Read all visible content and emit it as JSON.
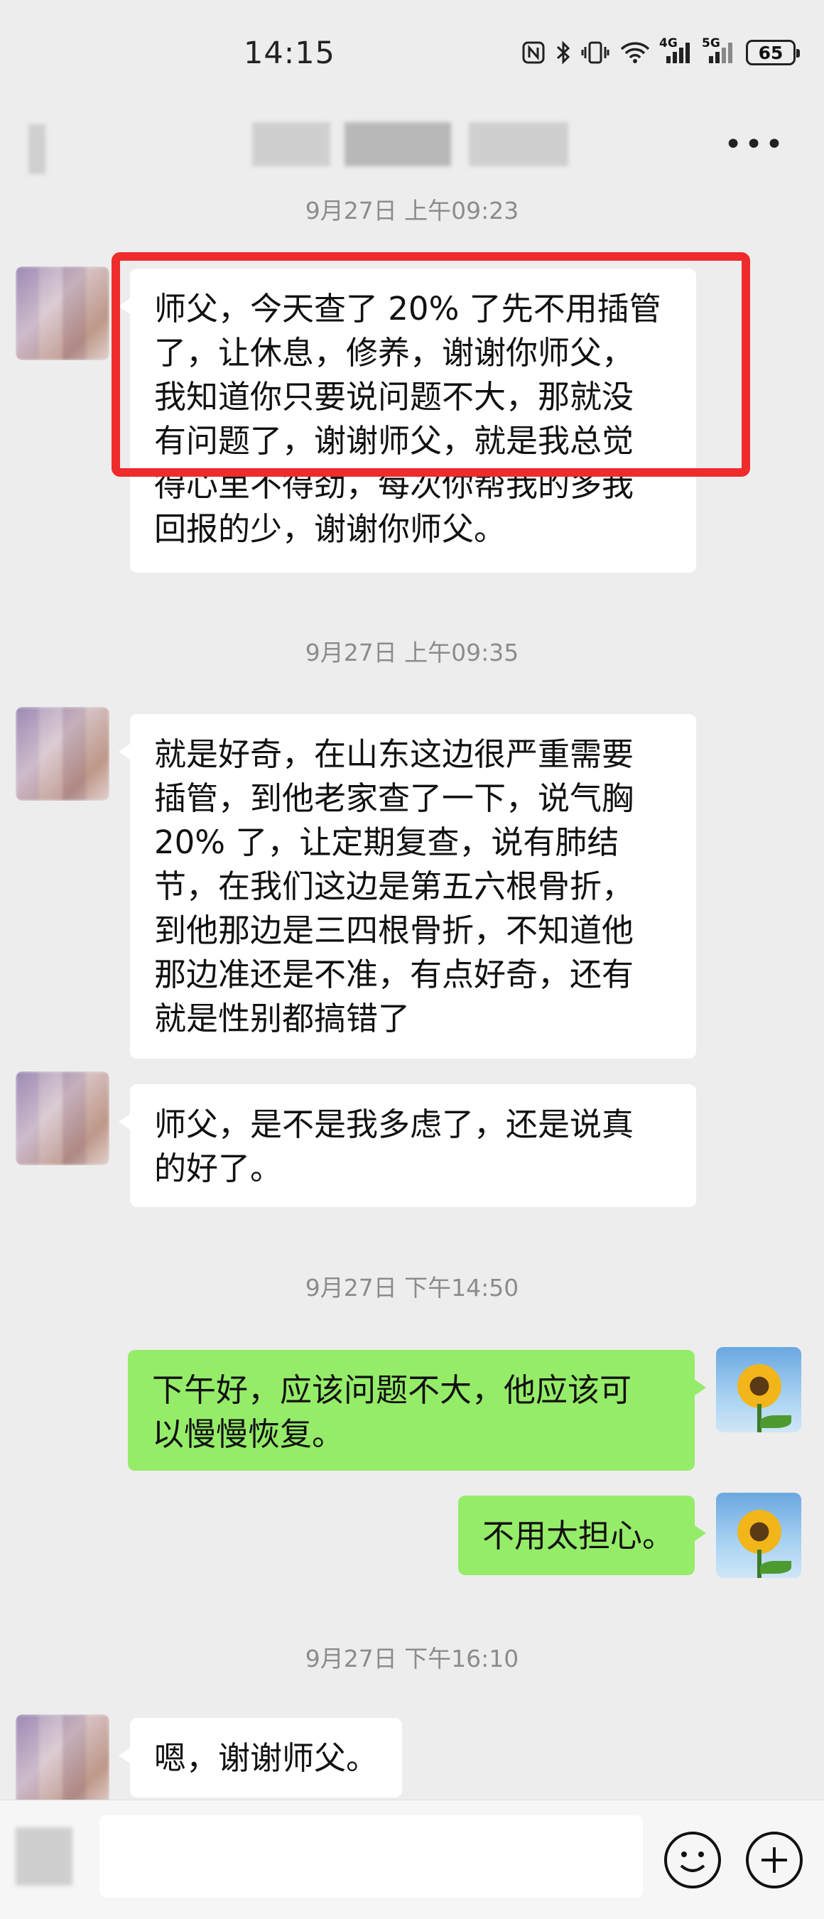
{
  "status_bar": {
    "time": "14:15",
    "network_4g": "4G",
    "network_5g": "5G",
    "battery": "65"
  },
  "messages": {
    "ts1": "9月27日 上午09:23",
    "m1": [
      "师父，今天查了 20% 了先不用插管",
      "了，让休息，修养，谢谢你师父，",
      "我知道你只要说问题不大，那就没",
      "有问题了，谢谢师父，就是我总觉",
      "得心里不得劲，每次你帮我的多我",
      "回报的少，谢谢你师父。"
    ],
    "ts2": "9月27日 上午09:35",
    "m2": [
      "就是好奇，在山东这边很严重需要",
      "插管，到他老家查了一下，说气胸",
      "20% 了，让定期复查，说有肺结",
      "节，在我们这边是第五六根骨折，",
      "到他那边是三四根骨折，不知道他",
      "那边准还是不准，有点好奇，还有",
      "就是性别都搞错了"
    ],
    "m3": [
      "师父，是不是我多虑了，还是说真",
      "的好了。"
    ],
    "ts3": "9月27日 下午14:50",
    "m4": [
      "下午好，应该问题不大，他应该可",
      "以慢慢恢复。"
    ],
    "m5": [
      "不用太担心。"
    ],
    "ts4": "9月27日 下午16:10",
    "m6": [
      "嗯，谢谢师父。"
    ]
  },
  "icons": {
    "more": "more-dots-icon",
    "emoji": "emoji-icon",
    "add": "plus-icon"
  }
}
